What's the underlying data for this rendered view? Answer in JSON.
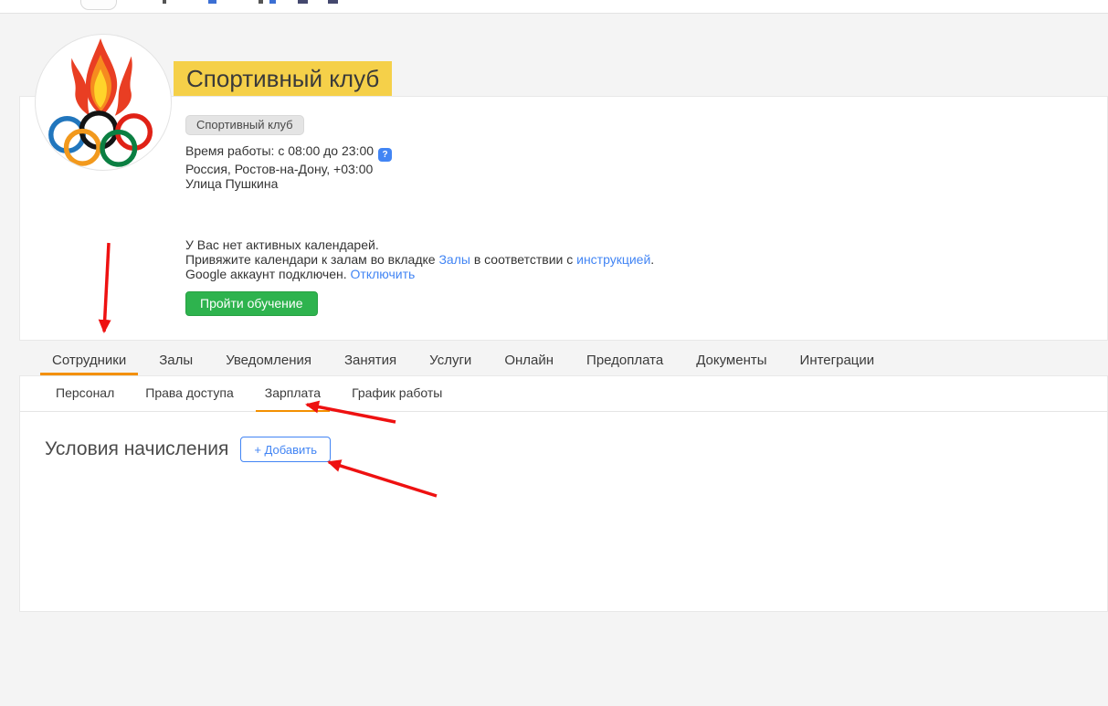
{
  "club": {
    "title": "Спортивный клуб",
    "badge": "Спортивный клуб",
    "hours": "Время работы: с 08:00 до 23:00",
    "help_icon": "?",
    "location": "Россия, Ростов-на-Дону, +03:00",
    "address": "Улица Пушкина"
  },
  "calendar": {
    "no_active": "У Вас нет активных календарей.",
    "attach_prefix": "Привяжите календари к залам во вкладке ",
    "attach_link_halls": "Залы",
    "attach_middle": " в соответствии с ",
    "attach_link_instruction": "инструкцией",
    "attach_suffix": ".",
    "google_status": "Google аккаунт подключен. ",
    "google_disconnect_link": "Отключить",
    "training_button": "Пройти обучение"
  },
  "tabs": {
    "items": [
      {
        "label": "Сотрудники",
        "active": true
      },
      {
        "label": "Залы"
      },
      {
        "label": "Уведомления"
      },
      {
        "label": "Занятия"
      },
      {
        "label": "Услуги"
      },
      {
        "label": "Онлайн"
      },
      {
        "label": "Предоплата"
      },
      {
        "label": "Документы"
      },
      {
        "label": "Интеграции"
      }
    ]
  },
  "subtabs": {
    "items": [
      {
        "label": "Персонал"
      },
      {
        "label": "Права доступа"
      },
      {
        "label": "Зарплата",
        "active": true
      },
      {
        "label": "График работы"
      }
    ]
  },
  "salary": {
    "heading": "Условия начисления",
    "add_button": "+ Добавить"
  },
  "colors": {
    "accent_orange": "#f39000",
    "link_blue": "#4285f4",
    "button_green": "#2eb34e",
    "arrow_red": "#ee1111",
    "title_highlight_yellow": "#f5d049"
  }
}
